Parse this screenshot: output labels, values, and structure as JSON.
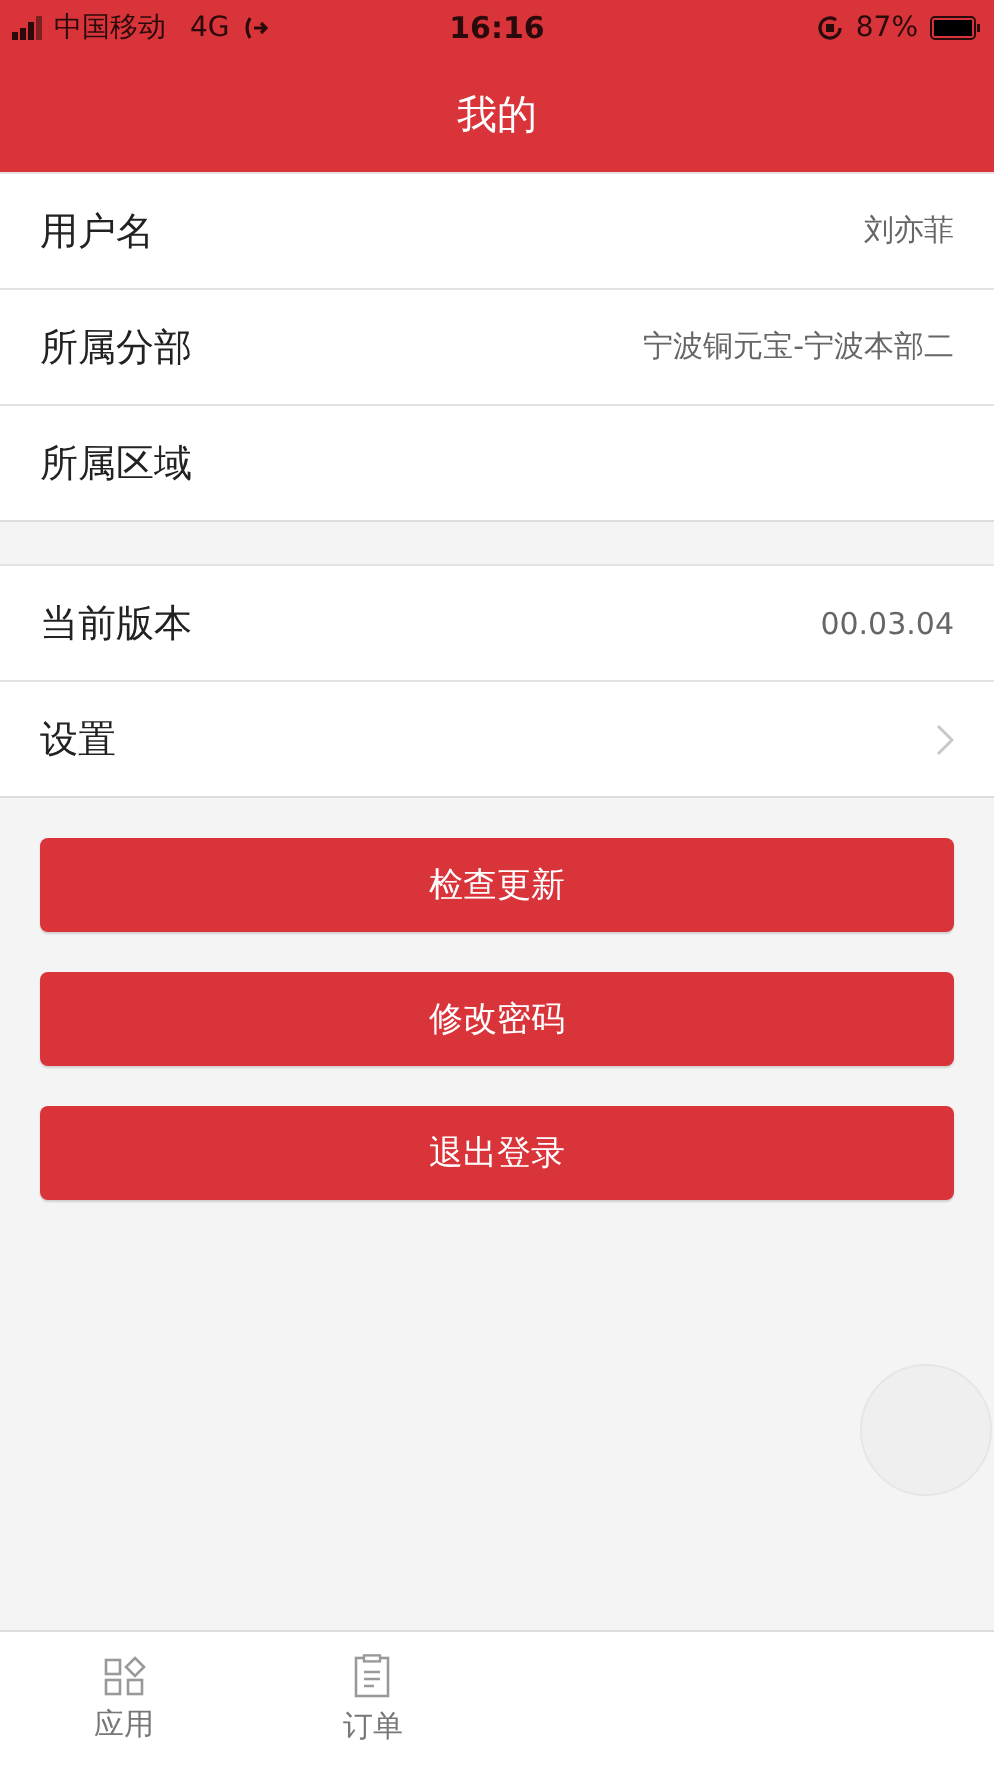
{
  "status_bar": {
    "carrier": "中国移动",
    "network": "4G",
    "time": "16:16",
    "battery": "87%"
  },
  "header": {
    "title": "我的"
  },
  "sections": [
    {
      "rows": [
        {
          "kind": "info",
          "label": "用户名",
          "value": "刘亦菲"
        },
        {
          "kind": "info",
          "label": "所属分部",
          "value": "宁波铜元宝-宁波本部二"
        },
        {
          "kind": "info",
          "label": "所属区域"
        }
      ]
    },
    {
      "rows": [
        {
          "kind": "info",
          "label": "当前版本",
          "value": "00.03.04"
        },
        {
          "kind": "link",
          "label": "设置"
        }
      ]
    }
  ],
  "buttons": [
    "检查更新",
    "修改密码",
    "退出登录"
  ],
  "tab_bar": [
    {
      "kind": "grid",
      "label": "应用"
    },
    {
      "kind": "clipboard",
      "label": "订单"
    }
  ]
}
